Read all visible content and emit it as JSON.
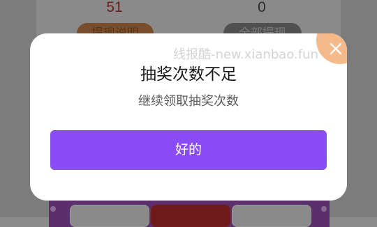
{
  "background": {
    "stats": {
      "left_value": "51",
      "right_value": "0"
    },
    "buttons": {
      "left_label": "提现说明",
      "right_label": "全部提现"
    }
  },
  "dialog": {
    "title": "抽奖次数不足",
    "message": "继续领取抽奖次数",
    "confirm_label": "好的",
    "close_icon": "close-icon",
    "watermark": "线报酷-new.xianbao.fun"
  },
  "colors": {
    "accent": "#8a4cf7",
    "close_badge": "#f6b98a"
  }
}
